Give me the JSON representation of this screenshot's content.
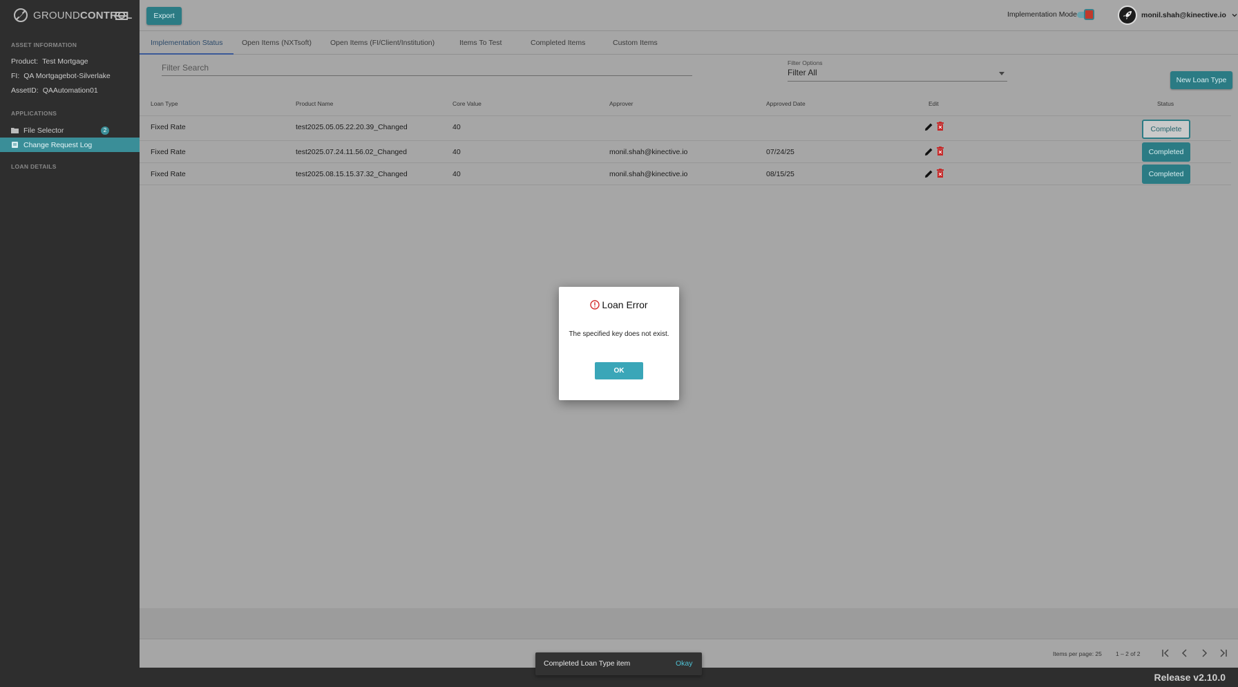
{
  "brand": {
    "name_light": "GROUND",
    "name_bold": "CONTROL"
  },
  "sidebar": {
    "asset_section": "ASSET INFORMATION",
    "asset": [
      {
        "key": "Product:",
        "value": "Test Mortgage"
      },
      {
        "key": "FI:",
        "value": "QA Mortgagebot-Silverlake"
      },
      {
        "key": "AssetID:",
        "value": "QAAutomation01"
      }
    ],
    "applications_section": "APPLICATIONS",
    "applications": [
      {
        "label": "File Selector",
        "icon": "folder-icon",
        "badge": "2"
      },
      {
        "label": "Change Request Log",
        "icon": "document-icon"
      }
    ],
    "loan_section": "LOAN DETAILS"
  },
  "topbar": {
    "export_label": "Export",
    "implementation_mode_label": "Implementation Mode",
    "user_email": "monil.shah@kinective.io"
  },
  "tabs": [
    {
      "label": "Implementation Status",
      "active": true
    },
    {
      "label": "Open Items (NXTsoft)"
    },
    {
      "label": "Open Items (FI/Client/Institution)"
    },
    {
      "label": "Items To Test"
    },
    {
      "label": "Completed Items"
    },
    {
      "label": "Custom Items"
    }
  ],
  "filter": {
    "search_placeholder": "Filter Search",
    "options_label": "Filter Options",
    "options_value": "Filter All",
    "new_button": "New Loan Type"
  },
  "table": {
    "headers": [
      "Loan Type",
      "Product Name",
      "Core Value",
      "Approver",
      "Approved Date",
      "Edit",
      "Status"
    ],
    "rows": [
      {
        "loan_type": "Fixed Rate",
        "product": "test2025.05.05.22.20.39_Changed",
        "core": "40",
        "approver": "",
        "date": "",
        "status": "Complete"
      },
      {
        "loan_type": "Fixed Rate",
        "product": "test2025.07.24.11.56.02_Changed",
        "core": "40",
        "approver": "monil.shah@kinective.io",
        "date": "07/24/25",
        "status": "Completed"
      },
      {
        "loan_type": "Fixed Rate",
        "product": "test2025.08.15.15.37.32_Changed",
        "core": "40",
        "approver": "monil.shah@kinective.io",
        "date": "08/15/25",
        "status": "Completed"
      }
    ]
  },
  "paginator": {
    "items_per_page": "Items per page: 25",
    "range": "1 – 2 of 2"
  },
  "dialog": {
    "title": "Loan Error",
    "message": "The specified key does not exist.",
    "ok": "OK"
  },
  "snackbar": {
    "message": "Completed Loan Type item",
    "action": "Okay"
  },
  "footer": {
    "release": "Release v2.10.0"
  },
  "colors": {
    "accent": "#2b7b84",
    "active_item": "#3a8e98",
    "error": "#d32f2f",
    "snack_action": "#4fc3d6"
  }
}
